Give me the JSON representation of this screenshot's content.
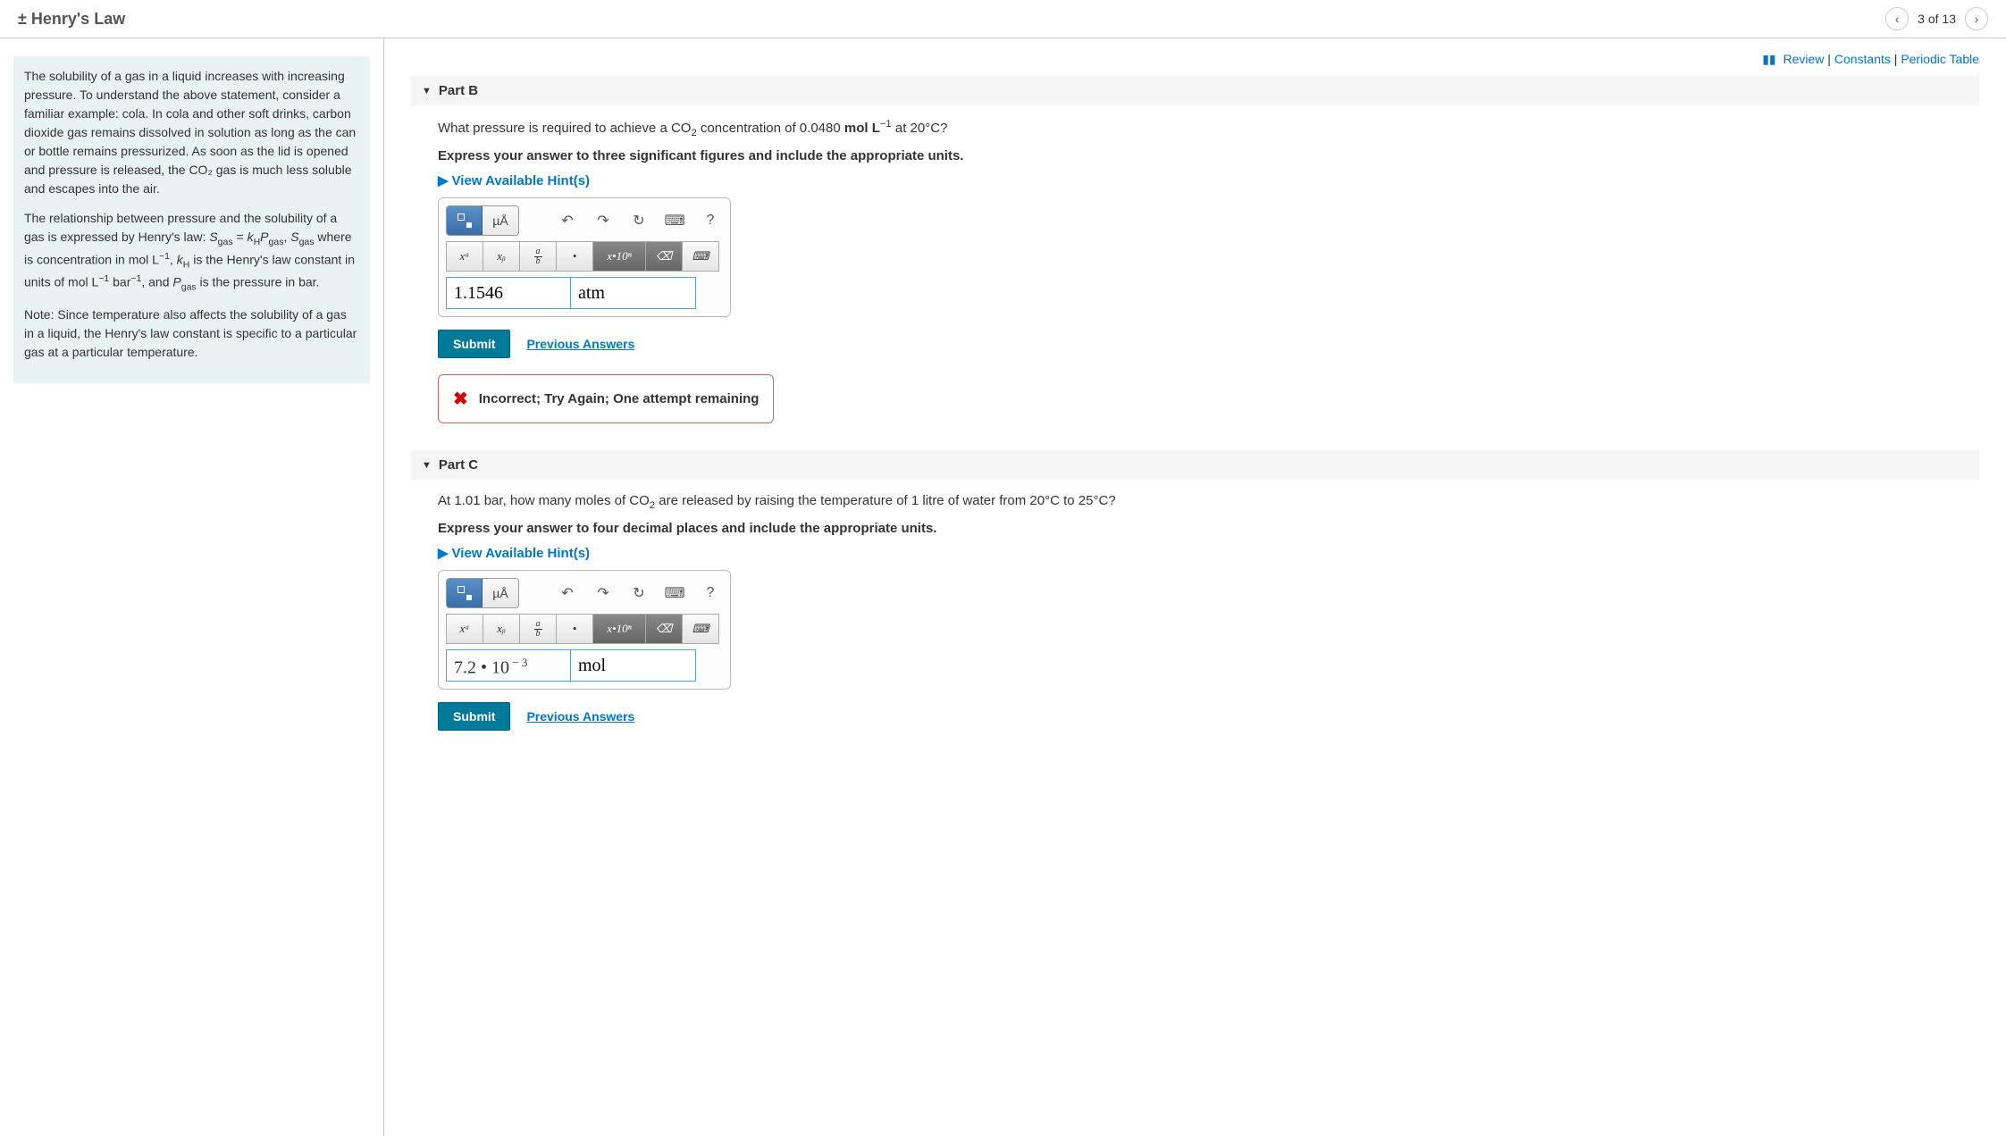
{
  "header": {
    "title": "± Henry's Law",
    "nav_text": "3 of 13"
  },
  "top_links": {
    "review": "Review",
    "constants": "Constants",
    "periodic": "Periodic Table"
  },
  "sidebar": {
    "p1": "The solubility of a gas in a liquid increases with increasing pressure. To understand the above statement, consider a familiar example: cola. In cola and other soft drinks, carbon dioxide gas remains dissolved in solution as long as the can or bottle remains pressurized. As soon as the lid is opened and pressure is released, the CO₂ gas is much less soluble and escapes into the air.",
    "p2_a": "The relationship between pressure and the solubility of a gas is expressed by Henry's law: ",
    "p2_b": " where is concentration in ",
    "p2_c": " is the Henry's law constant in units of ",
    "p2_d": " is the pressure in ",
    "p3": "Note: Since temperature also affects the solubility of a gas in a liquid, the Henry's law constant is specific to a particular gas at a particular temperature."
  },
  "partB": {
    "label": "Part B",
    "question_a": "What pressure is required to achieve a ",
    "question_b": " concentration of 0.0480 ",
    "question_c": " at 20°",
    "question_d": "?",
    "instruction": "Express your answer to three significant figures and include the appropriate units.",
    "hints": "View Available Hint(s)",
    "value": "1.1546",
    "unit": "atm",
    "submit": "Submit",
    "prev": "Previous Answers",
    "feedback": "Incorrect; Try Again; One attempt remaining"
  },
  "partC": {
    "label": "Part C",
    "question_a": "At 1.01 ",
    "question_b": ", how many moles of ",
    "question_c": " are released by raising the temperature of 1 litre of water from 20°",
    "question_d": " to 25°",
    "question_e": "?",
    "instruction": "Express your answer to four decimal places and include the appropriate units.",
    "hints": "View Available Hint(s)",
    "value_html": "7.2 • 10⁻³",
    "unit": "mol",
    "submit": "Submit",
    "prev": "Previous Answers"
  },
  "toolbar": {
    "mu_a": "µÅ",
    "xa": "xᵃ",
    "xb": "xᵦ",
    "dot": "•",
    "sci": "x•10ⁿ",
    "help": "?"
  }
}
